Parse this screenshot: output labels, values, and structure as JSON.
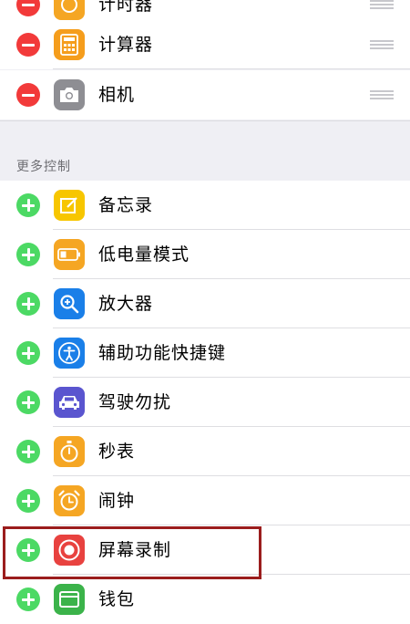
{
  "included": {
    "items": [
      {
        "label": "计时器",
        "icon": "timer-icon",
        "action": "remove"
      },
      {
        "label": "计算器",
        "icon": "calculator-icon",
        "action": "remove"
      },
      {
        "label": "相机",
        "icon": "camera-icon",
        "action": "remove"
      }
    ]
  },
  "more_controls": {
    "title": "更多控制",
    "items": [
      {
        "label": "备忘录",
        "icon": "notes-icon",
        "action": "add"
      },
      {
        "label": "低电量模式",
        "icon": "low-power-mode-icon",
        "action": "add"
      },
      {
        "label": "放大器",
        "icon": "magnifier-icon",
        "action": "add"
      },
      {
        "label": "辅助功能快捷键",
        "icon": "accessibility-icon",
        "action": "add"
      },
      {
        "label": "驾驶勿扰",
        "icon": "car-icon",
        "action": "add"
      },
      {
        "label": "秒表",
        "icon": "stopwatch-icon",
        "action": "add"
      },
      {
        "label": "闹钟",
        "icon": "alarm-clock-icon",
        "action": "add"
      },
      {
        "label": "屏幕录制",
        "icon": "screen-record-icon",
        "action": "add",
        "highlighted": true
      },
      {
        "label": "钱包",
        "icon": "wallet-icon",
        "action": "add"
      }
    ]
  },
  "colors": {
    "remove": "#f23a3a",
    "add": "#4cd964",
    "highlight": "#9b1d1d"
  }
}
